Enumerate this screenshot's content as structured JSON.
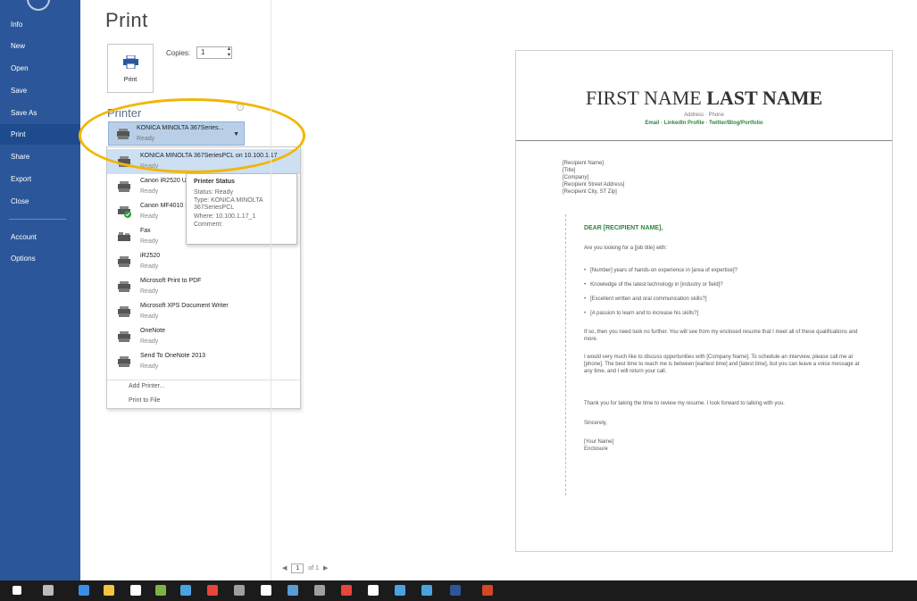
{
  "sidebar": {
    "items": [
      {
        "label": "Info"
      },
      {
        "label": "New"
      },
      {
        "label": "Open"
      },
      {
        "label": "Save"
      },
      {
        "label": "Save As"
      },
      {
        "label": "Print"
      },
      {
        "label": "Share"
      },
      {
        "label": "Export"
      },
      {
        "label": "Close"
      },
      {
        "label": "Account"
      },
      {
        "label": "Options"
      }
    ],
    "active": "Print"
  },
  "main": {
    "title": "Print",
    "print_button": "Print",
    "copies_label": "Copies:",
    "copies_value": "1",
    "printer_section_title": "Printer",
    "info_icon": "i",
    "selected_printer": {
      "name": "KONICA MINOLTA 367Series...",
      "status": "Ready"
    },
    "printers": [
      {
        "name": "KONICA MINOLTA 367SeriesPCL on 10.100.1.17",
        "status": "Ready",
        "icon": "printer-icon"
      },
      {
        "name": "Canon iR2520 UFI",
        "status": "Ready",
        "icon": "printer-icon"
      },
      {
        "name": "Canon MF4010 Se",
        "status": "Ready",
        "icon": "printer-default-check-icon"
      },
      {
        "name": "Fax",
        "status": "Ready",
        "icon": "fax-icon"
      },
      {
        "name": "iR2520",
        "status": "Ready",
        "icon": "printer-icon"
      },
      {
        "name": "Microsoft Print to PDF",
        "status": "Ready",
        "icon": "printer-icon"
      },
      {
        "name": "Microsoft XPS Document Writer",
        "status": "Ready",
        "icon": "printer-icon"
      },
      {
        "name": "OneNote",
        "status": "Ready",
        "icon": "printer-icon"
      },
      {
        "name": "Send To OneNote 2013",
        "status": "Ready",
        "icon": "printer-icon"
      }
    ],
    "add_printer": "Add Printer...",
    "print_to_file": "Print to File",
    "tooltip": {
      "title": "Printer Status",
      "status": "Status: Ready",
      "type": "Type: KONICA MINOLTA 367SeriesPCL",
      "where": "Where: 10.100.1.17_1",
      "comment": "Comment:"
    }
  },
  "preview": {
    "name_first": "FIRST NAME ",
    "name_last": "LAST NAME",
    "address": "Address · Phone",
    "links": "Email · LinkedIn Profile · Twitter/Blog/Portfolio",
    "recipient": [
      "[Recipient Name]",
      "[Title]",
      "[Company]",
      "[Recipient Street Address]",
      "[Recipient City, ST Zip]"
    ],
    "greeting": "DEAR [RECIPIENT NAME],",
    "intro": "Are you looking for a [job title] with:",
    "bullets": [
      "[Number] years of hands-on experience in [area of expertise]?",
      "Knowledge of the latest technology in [industry or field]?",
      "[Excellent written and oral communication skills?]",
      "[A passion to learn and to increase his skills?]"
    ],
    "para1": "If so, then you need look no further. You will see from my enclosed resume that I meet all of these qualifications and more.",
    "para2": "I would very much like to discuss opportunities with [Company Name]. To schedule an interview, please call me at [phone]. The best time to reach me is between [earliest time] and [latest time], but you can leave a voice message at any time, and I will return your call.",
    "para3": "Thank you for taking the time to review my resume. I look forward to talking with you.",
    "closing": "Sincerely,",
    "signature": "[Your Name]",
    "enclosure": "Enclosure"
  },
  "page_nav": {
    "prev": "◀",
    "current": "1",
    "of": "of 1",
    "next": "▶"
  },
  "taskbar": {
    "icons": [
      {
        "name": "start-icon",
        "color": "#ffffff"
      },
      {
        "name": "task-view-icon",
        "color": "#bbbbbb"
      },
      {
        "name": "edge-icon",
        "color": "#3a8ee6"
      },
      {
        "name": "file-explorer-icon",
        "color": "#f4c542"
      },
      {
        "name": "store-icon",
        "color": "#ffffff"
      },
      {
        "name": "app-icon",
        "color": "#7cb342"
      },
      {
        "name": "app-icon",
        "color": "#4aa3df"
      },
      {
        "name": "chrome-icon",
        "color": "#e8453c"
      },
      {
        "name": "app-icon",
        "color": "#9e9e9e"
      },
      {
        "name": "mail-icon",
        "color": "#ffffff"
      },
      {
        "name": "app-icon",
        "color": "#5b9bd5"
      },
      {
        "name": "app-icon",
        "color": "#9aa0a6"
      },
      {
        "name": "app-icon",
        "color": "#e8453c"
      },
      {
        "name": "settings-icon",
        "color": "#ffffff"
      },
      {
        "name": "app-icon",
        "color": "#4aa3df"
      },
      {
        "name": "network-icon",
        "color": "#4aa3df"
      },
      {
        "name": "word-icon",
        "color": "#2b579a"
      },
      {
        "name": "powerpoint-icon",
        "color": "#d24726"
      }
    ]
  }
}
